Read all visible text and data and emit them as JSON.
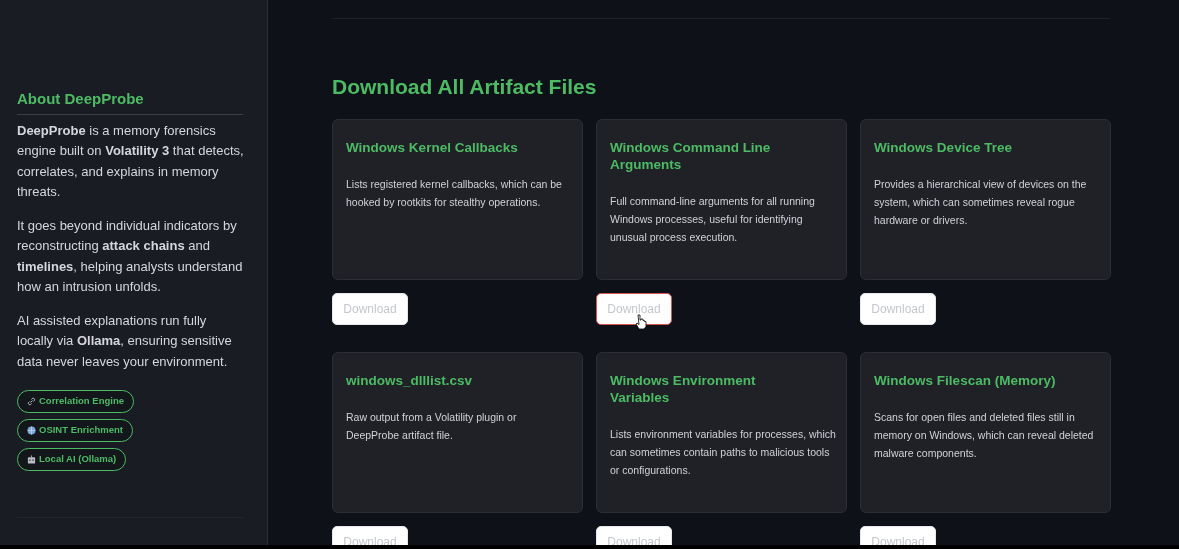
{
  "sidebar": {
    "title": "About DeepProbe",
    "paragraphs": [
      "**DeepProbe** is a memory forensics engine built on **Volatility 3** that detects, correlates, and explains in memory threats.",
      "It goes beyond individual indicators by reconstructing **attack chains** and **timelines**, helping analysts understand how an intrusion unfolds.",
      "AI assisted explanations run fully locally via **Ollama**, ensuring sensitive data never leaves your environment."
    ],
    "badges": [
      {
        "kind": "link",
        "label": "Correlation Engine"
      },
      {
        "kind": "globe",
        "label": "OSINT Enrichment"
      },
      {
        "kind": "robot",
        "label": "Local AI (Ollama)"
      }
    ]
  },
  "main": {
    "title": "Download All Artifact Files",
    "cards": [
      {
        "title": "Windows Kernel Callbacks",
        "description": "Lists registered kernel callbacks, which can be hooked by rootkits for stealthy operations.",
        "button": "Download",
        "hovered": false
      },
      {
        "title": "Windows Command Line Arguments",
        "description": "Full command-line arguments for all running Windows processes, useful for identifying unusual process execution.",
        "button": "Download",
        "hovered": true
      },
      {
        "title": "Windows Device Tree",
        "description": "Provides a hierarchical view of devices on the system, which can sometimes reveal rogue hardware or drivers.",
        "button": "Download",
        "hovered": false
      },
      {
        "title": "windows_dlllist.csv",
        "description": "Raw output from a Volatility plugin or DeepProbe artifact file.",
        "button": "Download",
        "hovered": false
      },
      {
        "title": "Windows Environment Variables",
        "description": "Lists environment variables for processes, which can sometimes contain paths to malicious tools or configurations.",
        "button": "Download",
        "hovered": false
      },
      {
        "title": "Windows Filescan (Memory)",
        "description": "Scans for open files and deleted files still in memory on Windows, which can reveal deleted malware components.",
        "button": "Download",
        "hovered": false
      }
    ]
  }
}
